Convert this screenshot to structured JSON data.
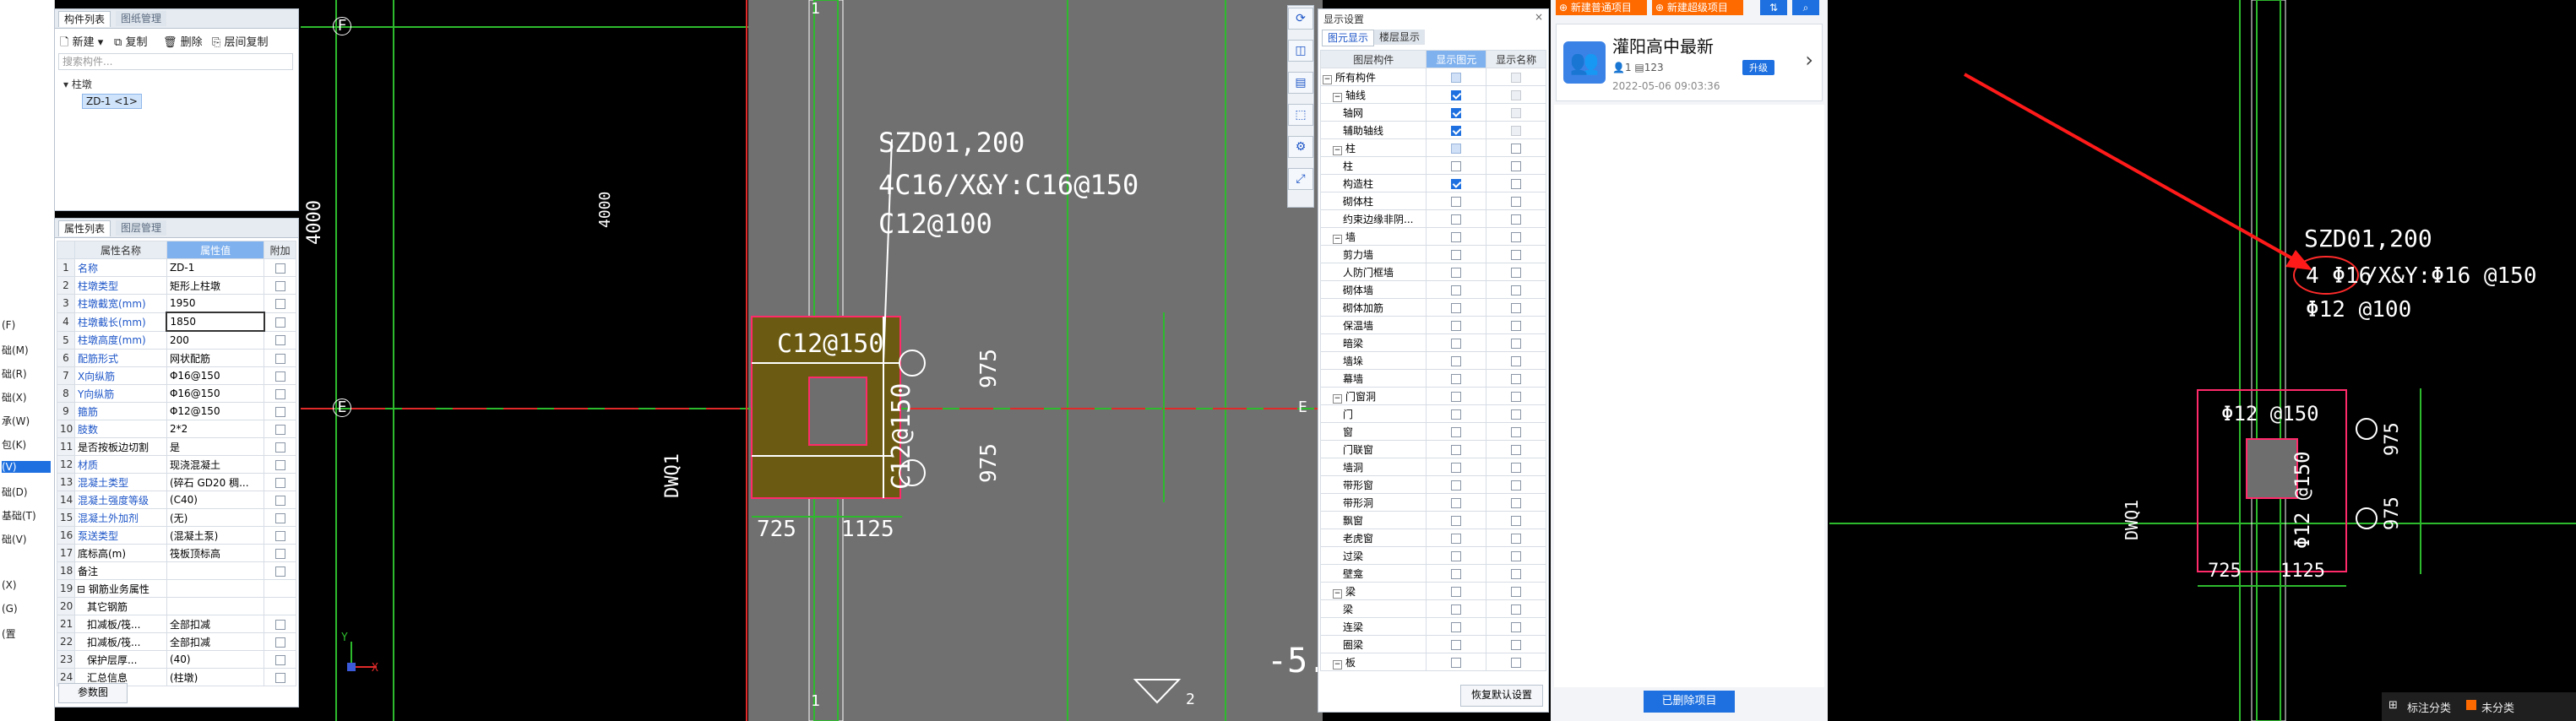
{
  "left_menu": [
    "(F)",
    "础(M)",
    "础(R)",
    "础(X)",
    "承(W)",
    "包(K)",
    "(V)",
    "础(D)",
    "基础(T)",
    "础(V)",
    "(X)",
    "(G)",
    "(置"
  ],
  "component_panel": {
    "tabs": [
      "构件列表",
      "图纸管理"
    ],
    "toolbar": {
      "new": "新建",
      "copy": "复制",
      "delete": "删除",
      "layer_copy": "层间复制"
    },
    "search_placeholder": "搜索构件...",
    "tree_root": "柱墩",
    "tree_item": "ZD-1 <1>"
  },
  "property_panel": {
    "tabs": [
      "属性列表",
      "图层管理"
    ],
    "headers": [
      "属性名称",
      "属性值",
      "附加"
    ],
    "rows": [
      {
        "no": "1",
        "name": "名称",
        "value": "ZD-1"
      },
      {
        "no": "2",
        "name": "柱墩类型",
        "value": "矩形上柱墩"
      },
      {
        "no": "3",
        "name": "柱墩截宽(mm)",
        "value": "1950"
      },
      {
        "no": "4",
        "name": "柱墩截长(mm)",
        "value": "1850"
      },
      {
        "no": "5",
        "name": "柱墩高度(mm)",
        "value": "200"
      },
      {
        "no": "6",
        "name": "配筋形式",
        "value": "网状配筋"
      },
      {
        "no": "7",
        "name": "X向纵筋",
        "value": "Φ16@150"
      },
      {
        "no": "8",
        "name": "Y向纵筋",
        "value": "Φ16@150"
      },
      {
        "no": "9",
        "name": "箍筋",
        "value": "Φ12@150"
      },
      {
        "no": "10",
        "name": "肢数",
        "value": "2*2"
      },
      {
        "no": "11",
        "name": "是否按板边切割",
        "value": "是"
      },
      {
        "no": "12",
        "name": "材质",
        "value": "现浇混凝土"
      },
      {
        "no": "13",
        "name": "混凝土类型",
        "value": "(碎石 GD20 稠..."
      },
      {
        "no": "14",
        "name": "混凝土强度等级",
        "value": "(C40)"
      },
      {
        "no": "15",
        "name": "混凝土外加剂",
        "value": "(无)"
      },
      {
        "no": "16",
        "name": "泵送类型",
        "value": "(混凝土泵)"
      },
      {
        "no": "17",
        "name": "底标高(m)",
        "value": "筏板顶标高"
      },
      {
        "no": "18",
        "name": "备注",
        "value": ""
      },
      {
        "no": "19",
        "name": "钢筋业务属性",
        "value": ""
      },
      {
        "no": "20",
        "name": "其它钢筋",
        "value": ""
      },
      {
        "no": "21",
        "name": "扣减板/筏...",
        "value": "全部扣减"
      },
      {
        "no": "22",
        "name": "扣减板/筏...",
        "value": "全部扣减"
      },
      {
        "no": "23",
        "name": "保护层厚...",
        "value": "(40)"
      },
      {
        "no": "24",
        "name": "汇总信息",
        "value": "(柱墩)"
      }
    ],
    "footer_button": "参数图"
  },
  "cad": {
    "axis_labels": {
      "f": "F",
      "e": "E",
      "e_right": "E",
      "one_top": "1",
      "one_bottom": "1",
      "two": "2"
    },
    "dim_4000_left": "4000",
    "dim_4000_mid": "4000",
    "wall_label": "DWQ1",
    "annotation_line1": "SZD01,200",
    "annotation_line2": "4C16/X&Y:C16@150",
    "annotation_line3": "C12@100",
    "stirrup_h": "C12@150",
    "stirrup_v": "C12@150",
    "dim_975_a": "975",
    "dim_975_b": "975",
    "dim_725": "725",
    "dim_1125": "1125",
    "level_mark": "-5.",
    "ucs_x": "X",
    "ucs_y": "Y"
  },
  "display_panel": {
    "title": "显示设置",
    "tabs": [
      "图元显示",
      "楼层显示"
    ],
    "headers": [
      "图层构件",
      "显示图元",
      "显示名称"
    ],
    "rows": [
      {
        "label": "所有构件",
        "level": 0,
        "group": true,
        "show": "dim",
        "name": "dis"
      },
      {
        "label": "轴线",
        "level": 1,
        "group": true,
        "show": "on",
        "name": "dis"
      },
      {
        "label": "轴网",
        "level": 2,
        "group": false,
        "show": "on",
        "name": "dis"
      },
      {
        "label": "辅助轴线",
        "level": 2,
        "group": false,
        "show": "on",
        "name": "dis"
      },
      {
        "label": "柱",
        "level": 1,
        "group": true,
        "show": "dim",
        "name": "off"
      },
      {
        "label": "柱",
        "level": 2,
        "group": false,
        "show": "off",
        "name": "off"
      },
      {
        "label": "构造柱",
        "level": 2,
        "group": false,
        "show": "on",
        "name": "off"
      },
      {
        "label": "砌体柱",
        "level": 2,
        "group": false,
        "show": "off",
        "name": "off"
      },
      {
        "label": "约束边缘非阴...",
        "level": 2,
        "group": false,
        "show": "off",
        "name": "off"
      },
      {
        "label": "墙",
        "level": 1,
        "group": true,
        "show": "off",
        "name": "off"
      },
      {
        "label": "剪力墙",
        "level": 2,
        "group": false,
        "show": "off",
        "name": "off"
      },
      {
        "label": "人防门框墙",
        "level": 2,
        "group": false,
        "show": "off",
        "name": "off"
      },
      {
        "label": "砌体墙",
        "level": 2,
        "group": false,
        "show": "off",
        "name": "off"
      },
      {
        "label": "砌体加筋",
        "level": 2,
        "group": false,
        "show": "off",
        "name": "off"
      },
      {
        "label": "保温墙",
        "level": 2,
        "group": false,
        "show": "off",
        "name": "off"
      },
      {
        "label": "暗梁",
        "level": 2,
        "group": false,
        "show": "off",
        "name": "off"
      },
      {
        "label": "墙垛",
        "level": 2,
        "group": false,
        "show": "off",
        "name": "off"
      },
      {
        "label": "幕墙",
        "level": 2,
        "group": false,
        "show": "off",
        "name": "off"
      },
      {
        "label": "门窗洞",
        "level": 1,
        "group": true,
        "show": "off",
        "name": "off"
      },
      {
        "label": "门",
        "level": 2,
        "group": false,
        "show": "off",
        "name": "off"
      },
      {
        "label": "窗",
        "level": 2,
        "group": false,
        "show": "off",
        "name": "off"
      },
      {
        "label": "门联窗",
        "level": 2,
        "group": false,
        "show": "off",
        "name": "off"
      },
      {
        "label": "墙洞",
        "level": 2,
        "group": false,
        "show": "off",
        "name": "off"
      },
      {
        "label": "带形窗",
        "level": 2,
        "group": false,
        "show": "off",
        "name": "off"
      },
      {
        "label": "带形洞",
        "level": 2,
        "group": false,
        "show": "off",
        "name": "off"
      },
      {
        "label": "飘窗",
        "level": 2,
        "group": false,
        "show": "off",
        "name": "off"
      },
      {
        "label": "老虎窗",
        "level": 2,
        "group": false,
        "show": "off",
        "name": "off"
      },
      {
        "label": "过梁",
        "level": 2,
        "group": false,
        "show": "off",
        "name": "off"
      },
      {
        "label": "壁龛",
        "level": 2,
        "group": false,
        "show": "off",
        "name": "off"
      },
      {
        "label": "梁",
        "level": 1,
        "group": true,
        "show": "off",
        "name": "off"
      },
      {
        "label": "梁",
        "level": 2,
        "group": false,
        "show": "off",
        "name": "off"
      },
      {
        "label": "连梁",
        "level": 2,
        "group": false,
        "show": "off",
        "name": "off"
      },
      {
        "label": "圈梁",
        "level": 2,
        "group": false,
        "show": "off",
        "name": "off"
      },
      {
        "label": "板",
        "level": 1,
        "group": true,
        "show": "off",
        "name": "off"
      }
    ],
    "restore_button": "恢复默认设置"
  },
  "project_panel": {
    "btn_new_normal": "新建普通项目",
    "btn_new_super": "新建超级项目",
    "project_name": "灌阳高中最新",
    "member_count": "1",
    "file_count": "123",
    "upgrade_label": "升级",
    "date": "2022-05-06 09:03:36",
    "deleted_button": "已删除项目"
  },
  "ref_image": {
    "annotation_line1": "SZD01,200",
    "annotation_line2a": "4 Φ16",
    "annotation_line2b": "/X&Y:Φ16 @150",
    "annotation_line3": "Φ12 @100",
    "stirrup_h": "Φ12 @150",
    "stirrup_v": "Φ12 @150",
    "dim_975_a": "975",
    "dim_975_b": "975",
    "dim_725": "725",
    "dim_1125": "1125",
    "wall_label": "DWQ1"
  },
  "bottom_bar": {
    "label_category": "标注分类",
    "uncategorized": "未分类"
  },
  "colors": {
    "accent_blue": "#1e70e0",
    "highlight_orange": "#ff6a00",
    "cad_bg_gray": "#707070",
    "column_fill": "#6b5a12",
    "red_arrow": "#ff1a1a"
  }
}
